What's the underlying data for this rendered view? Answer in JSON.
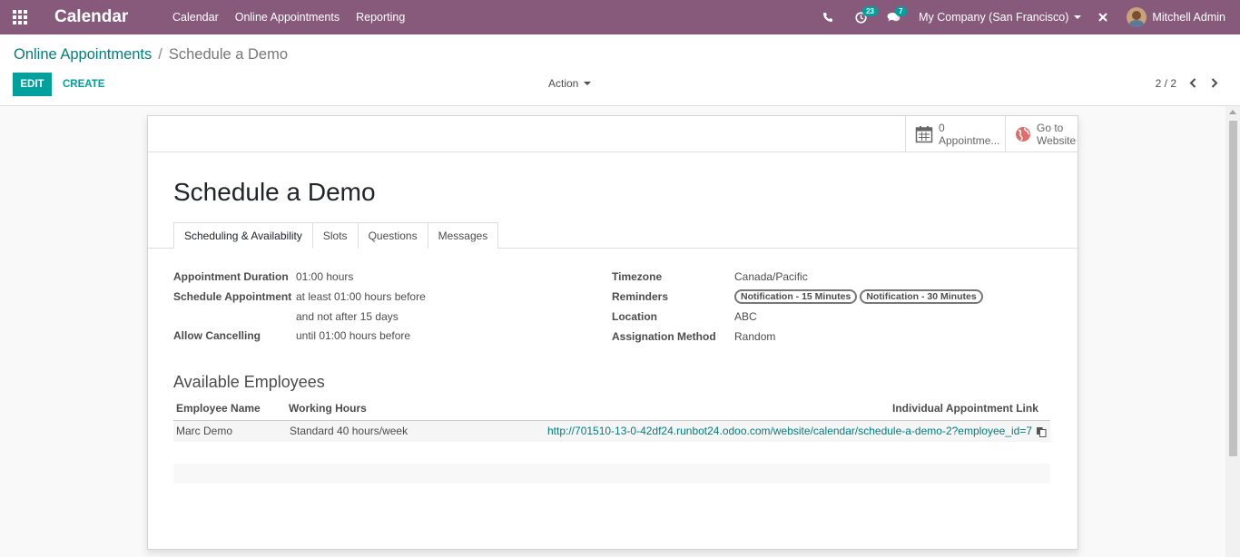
{
  "navbar": {
    "brand": "Calendar",
    "menu": [
      "Calendar",
      "Online Appointments",
      "Reporting"
    ],
    "activity_badge": "23",
    "messages_badge": "7",
    "company": "My Company (San Francisco)",
    "user": "Mitchell Admin"
  },
  "breadcrumb": {
    "parent": "Online Appointments",
    "separator": "/",
    "current": "Schedule a Demo"
  },
  "toolbar": {
    "edit_label": "EDIT",
    "create_label": "CREATE",
    "action_label": "Action",
    "pager": "2 / 2"
  },
  "stat_buttons": {
    "appointments_count": "0",
    "appointments_label": "Appointme...",
    "website_line1": "Go to",
    "website_line2": "Website"
  },
  "form": {
    "title": "Schedule a Demo",
    "tabs": [
      "Scheduling & Availability",
      "Slots",
      "Questions",
      "Messages"
    ],
    "left_fields": {
      "duration_label": "Appointment Duration",
      "duration_value": "01:00 hours",
      "schedule_label": "Schedule Appointment",
      "schedule_value1": "at least 01:00 hours before",
      "schedule_value2": "and not after 15 days",
      "cancel_label": "Allow Cancelling",
      "cancel_value": "until 01:00 hours before"
    },
    "right_fields": {
      "timezone_label": "Timezone",
      "timezone_value": "Canada/Pacific",
      "reminders_label": "Reminders",
      "reminders": [
        "Notification - 15 Minutes",
        "Notification - 30 Minutes"
      ],
      "location_label": "Location",
      "location_value": "ABC",
      "assignation_label": "Assignation Method",
      "assignation_value": "Random"
    },
    "employees": {
      "section_title": "Available Employees",
      "columns": [
        "Employee Name",
        "Working Hours",
        "Individual Appointment Link"
      ],
      "rows": [
        {
          "name": "Marc Demo",
          "hours": "Standard 40 hours/week",
          "link": "http://701510-13-0-42df24.runbot24.odoo.com/website/calendar/schedule-a-demo-2?employee_id=7"
        }
      ]
    }
  },
  "colors": {
    "navbar": "#875a7b",
    "primary": "#00a09d",
    "link": "#00807d"
  }
}
